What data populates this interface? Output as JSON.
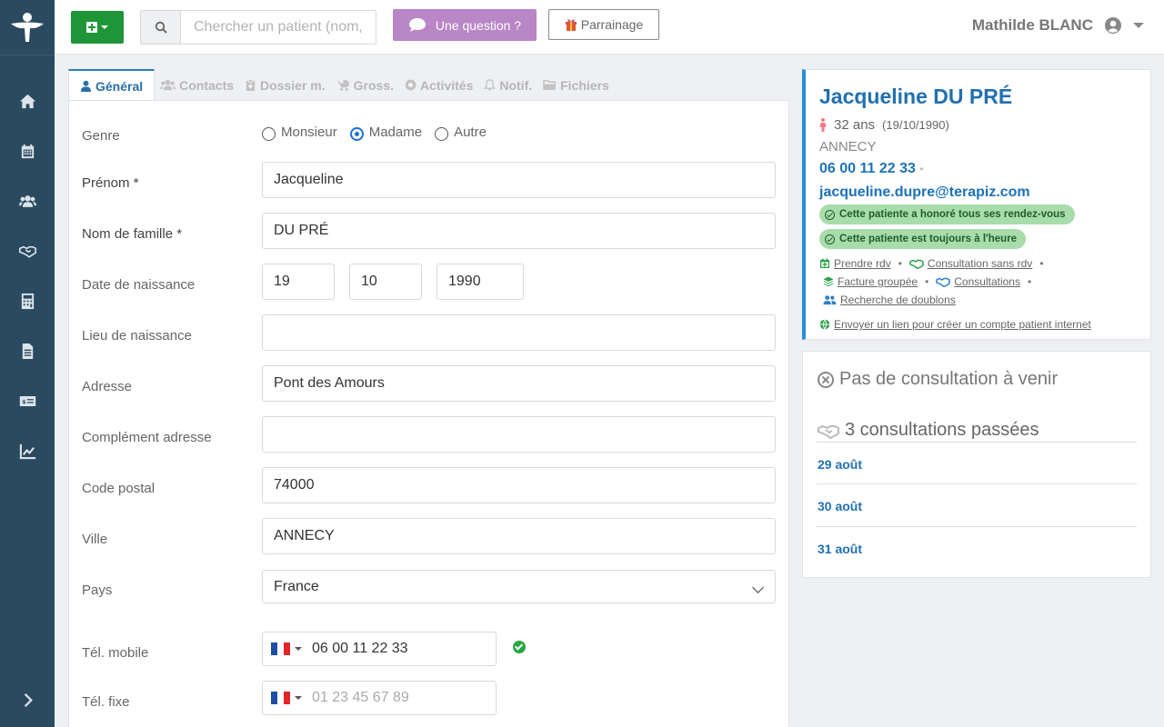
{
  "header": {
    "search_placeholder": "Chercher un patient (nom, prénom...)",
    "question_label": "Une question ?",
    "parrainage_label": "Parrainage",
    "user_name": "Mathilde BLANC"
  },
  "tabs": [
    {
      "label": "Général",
      "icon": "user-icon"
    },
    {
      "label": "Contacts",
      "icon": "users-icon"
    },
    {
      "label": "Dossier m.",
      "icon": "clipboard-icon"
    },
    {
      "label": "Gross.",
      "icon": "baby-carriage-icon"
    },
    {
      "label": "Activités",
      "icon": "ball-icon"
    },
    {
      "label": "Notif.",
      "icon": "bell-icon"
    },
    {
      "label": "Fichiers",
      "icon": "folder-icon"
    }
  ],
  "form": {
    "genre": {
      "label": "Genre",
      "options": [
        "Monsieur",
        "Madame",
        "Autre"
      ],
      "selected": "Madame"
    },
    "prenom": {
      "label": "Prénom *",
      "value": "Jacqueline"
    },
    "nom": {
      "label": "Nom de famille *",
      "value": "DU PRÉ"
    },
    "naissance": {
      "label": "Date de naissance",
      "day": "19",
      "month": "10",
      "year": "1990"
    },
    "lieu": {
      "label": "Lieu de naissance",
      "value": ""
    },
    "adresse": {
      "label": "Adresse",
      "value": "Pont des Amours"
    },
    "complement": {
      "label": "Complément adresse",
      "value": ""
    },
    "cp": {
      "label": "Code postal",
      "value": "74000"
    },
    "ville": {
      "label": "Ville",
      "value": "ANNECY"
    },
    "pays": {
      "label": "Pays",
      "value": "France"
    },
    "mobile": {
      "label": "Tél. mobile",
      "value": "06 00 11 22 33"
    },
    "fixe": {
      "label": "Tél. fixe",
      "placeholder": "01 23 45 67 89"
    }
  },
  "patient": {
    "name": "Jacqueline DU PRÉ",
    "age": "32 ans",
    "birth": "(19/10/1990)",
    "city": "ANNECY",
    "phone": "06 00 11 22 33",
    "phone_sep": "•",
    "email": "jacqueline.dupre@terapiz.com",
    "badges": [
      "Cette patiente a honoré tous ses rendez-vous",
      "Cette patiente est toujours à l'heure"
    ],
    "links": {
      "rdv": "Prendre rdv",
      "sans_rdv": "Consultation sans rdv",
      "facture": "Facture groupée",
      "consultations": "Consultations",
      "doublons": "Recherche de doublons",
      "compte": "Envoyer un lien pour créer un compte patient internet",
      "sep": "•"
    }
  },
  "consultations": {
    "upcoming": "Pas de consultation à venir",
    "past_title": "3 consultations passées",
    "past": [
      "29 août",
      "30 août",
      "31 août"
    ]
  },
  "colors": {
    "sidebar": "#2a4a60",
    "accent": "#2170b0",
    "green": "#1e9637",
    "question": "#b986c6"
  }
}
